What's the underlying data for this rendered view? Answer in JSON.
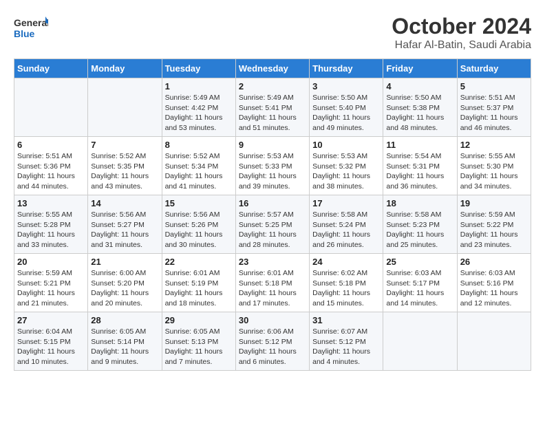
{
  "logo": {
    "text_general": "General",
    "text_blue": "Blue"
  },
  "header": {
    "month": "October 2024",
    "location": "Hafar Al-Batin, Saudi Arabia"
  },
  "weekdays": [
    "Sunday",
    "Monday",
    "Tuesday",
    "Wednesday",
    "Thursday",
    "Friday",
    "Saturday"
  ],
  "weeks": [
    [
      {
        "day": "",
        "sunrise": "",
        "sunset": "",
        "daylight": ""
      },
      {
        "day": "",
        "sunrise": "",
        "sunset": "",
        "daylight": ""
      },
      {
        "day": "1",
        "sunrise": "Sunrise: 5:49 AM",
        "sunset": "Sunset: 4:42 PM",
        "daylight": "Daylight: 11 hours and 53 minutes."
      },
      {
        "day": "2",
        "sunrise": "Sunrise: 5:49 AM",
        "sunset": "Sunset: 5:41 PM",
        "daylight": "Daylight: 11 hours and 51 minutes."
      },
      {
        "day": "3",
        "sunrise": "Sunrise: 5:50 AM",
        "sunset": "Sunset: 5:40 PM",
        "daylight": "Daylight: 11 hours and 49 minutes."
      },
      {
        "day": "4",
        "sunrise": "Sunrise: 5:50 AM",
        "sunset": "Sunset: 5:38 PM",
        "daylight": "Daylight: 11 hours and 48 minutes."
      },
      {
        "day": "5",
        "sunrise": "Sunrise: 5:51 AM",
        "sunset": "Sunset: 5:37 PM",
        "daylight": "Daylight: 11 hours and 46 minutes."
      }
    ],
    [
      {
        "day": "6",
        "sunrise": "Sunrise: 5:51 AM",
        "sunset": "Sunset: 5:36 PM",
        "daylight": "Daylight: 11 hours and 44 minutes."
      },
      {
        "day": "7",
        "sunrise": "Sunrise: 5:52 AM",
        "sunset": "Sunset: 5:35 PM",
        "daylight": "Daylight: 11 hours and 43 minutes."
      },
      {
        "day": "8",
        "sunrise": "Sunrise: 5:52 AM",
        "sunset": "Sunset: 5:34 PM",
        "daylight": "Daylight: 11 hours and 41 minutes."
      },
      {
        "day": "9",
        "sunrise": "Sunrise: 5:53 AM",
        "sunset": "Sunset: 5:33 PM",
        "daylight": "Daylight: 11 hours and 39 minutes."
      },
      {
        "day": "10",
        "sunrise": "Sunrise: 5:53 AM",
        "sunset": "Sunset: 5:32 PM",
        "daylight": "Daylight: 11 hours and 38 minutes."
      },
      {
        "day": "11",
        "sunrise": "Sunrise: 5:54 AM",
        "sunset": "Sunset: 5:31 PM",
        "daylight": "Daylight: 11 hours and 36 minutes."
      },
      {
        "day": "12",
        "sunrise": "Sunrise: 5:55 AM",
        "sunset": "Sunset: 5:30 PM",
        "daylight": "Daylight: 11 hours and 34 minutes."
      }
    ],
    [
      {
        "day": "13",
        "sunrise": "Sunrise: 5:55 AM",
        "sunset": "Sunset: 5:28 PM",
        "daylight": "Daylight: 11 hours and 33 minutes."
      },
      {
        "day": "14",
        "sunrise": "Sunrise: 5:56 AM",
        "sunset": "Sunset: 5:27 PM",
        "daylight": "Daylight: 11 hours and 31 minutes."
      },
      {
        "day": "15",
        "sunrise": "Sunrise: 5:56 AM",
        "sunset": "Sunset: 5:26 PM",
        "daylight": "Daylight: 11 hours and 30 minutes."
      },
      {
        "day": "16",
        "sunrise": "Sunrise: 5:57 AM",
        "sunset": "Sunset: 5:25 PM",
        "daylight": "Daylight: 11 hours and 28 minutes."
      },
      {
        "day": "17",
        "sunrise": "Sunrise: 5:58 AM",
        "sunset": "Sunset: 5:24 PM",
        "daylight": "Daylight: 11 hours and 26 minutes."
      },
      {
        "day": "18",
        "sunrise": "Sunrise: 5:58 AM",
        "sunset": "Sunset: 5:23 PM",
        "daylight": "Daylight: 11 hours and 25 minutes."
      },
      {
        "day": "19",
        "sunrise": "Sunrise: 5:59 AM",
        "sunset": "Sunset: 5:22 PM",
        "daylight": "Daylight: 11 hours and 23 minutes."
      }
    ],
    [
      {
        "day": "20",
        "sunrise": "Sunrise: 5:59 AM",
        "sunset": "Sunset: 5:21 PM",
        "daylight": "Daylight: 11 hours and 21 minutes."
      },
      {
        "day": "21",
        "sunrise": "Sunrise: 6:00 AM",
        "sunset": "Sunset: 5:20 PM",
        "daylight": "Daylight: 11 hours and 20 minutes."
      },
      {
        "day": "22",
        "sunrise": "Sunrise: 6:01 AM",
        "sunset": "Sunset: 5:19 PM",
        "daylight": "Daylight: 11 hours and 18 minutes."
      },
      {
        "day": "23",
        "sunrise": "Sunrise: 6:01 AM",
        "sunset": "Sunset: 5:18 PM",
        "daylight": "Daylight: 11 hours and 17 minutes."
      },
      {
        "day": "24",
        "sunrise": "Sunrise: 6:02 AM",
        "sunset": "Sunset: 5:18 PM",
        "daylight": "Daylight: 11 hours and 15 minutes."
      },
      {
        "day": "25",
        "sunrise": "Sunrise: 6:03 AM",
        "sunset": "Sunset: 5:17 PM",
        "daylight": "Daylight: 11 hours and 14 minutes."
      },
      {
        "day": "26",
        "sunrise": "Sunrise: 6:03 AM",
        "sunset": "Sunset: 5:16 PM",
        "daylight": "Daylight: 11 hours and 12 minutes."
      }
    ],
    [
      {
        "day": "27",
        "sunrise": "Sunrise: 6:04 AM",
        "sunset": "Sunset: 5:15 PM",
        "daylight": "Daylight: 11 hours and 10 minutes."
      },
      {
        "day": "28",
        "sunrise": "Sunrise: 6:05 AM",
        "sunset": "Sunset: 5:14 PM",
        "daylight": "Daylight: 11 hours and 9 minutes."
      },
      {
        "day": "29",
        "sunrise": "Sunrise: 6:05 AM",
        "sunset": "Sunset: 5:13 PM",
        "daylight": "Daylight: 11 hours and 7 minutes."
      },
      {
        "day": "30",
        "sunrise": "Sunrise: 6:06 AM",
        "sunset": "Sunset: 5:12 PM",
        "daylight": "Daylight: 11 hours and 6 minutes."
      },
      {
        "day": "31",
        "sunrise": "Sunrise: 6:07 AM",
        "sunset": "Sunset: 5:12 PM",
        "daylight": "Daylight: 11 hours and 4 minutes."
      },
      {
        "day": "",
        "sunrise": "",
        "sunset": "",
        "daylight": ""
      },
      {
        "day": "",
        "sunrise": "",
        "sunset": "",
        "daylight": ""
      }
    ]
  ]
}
